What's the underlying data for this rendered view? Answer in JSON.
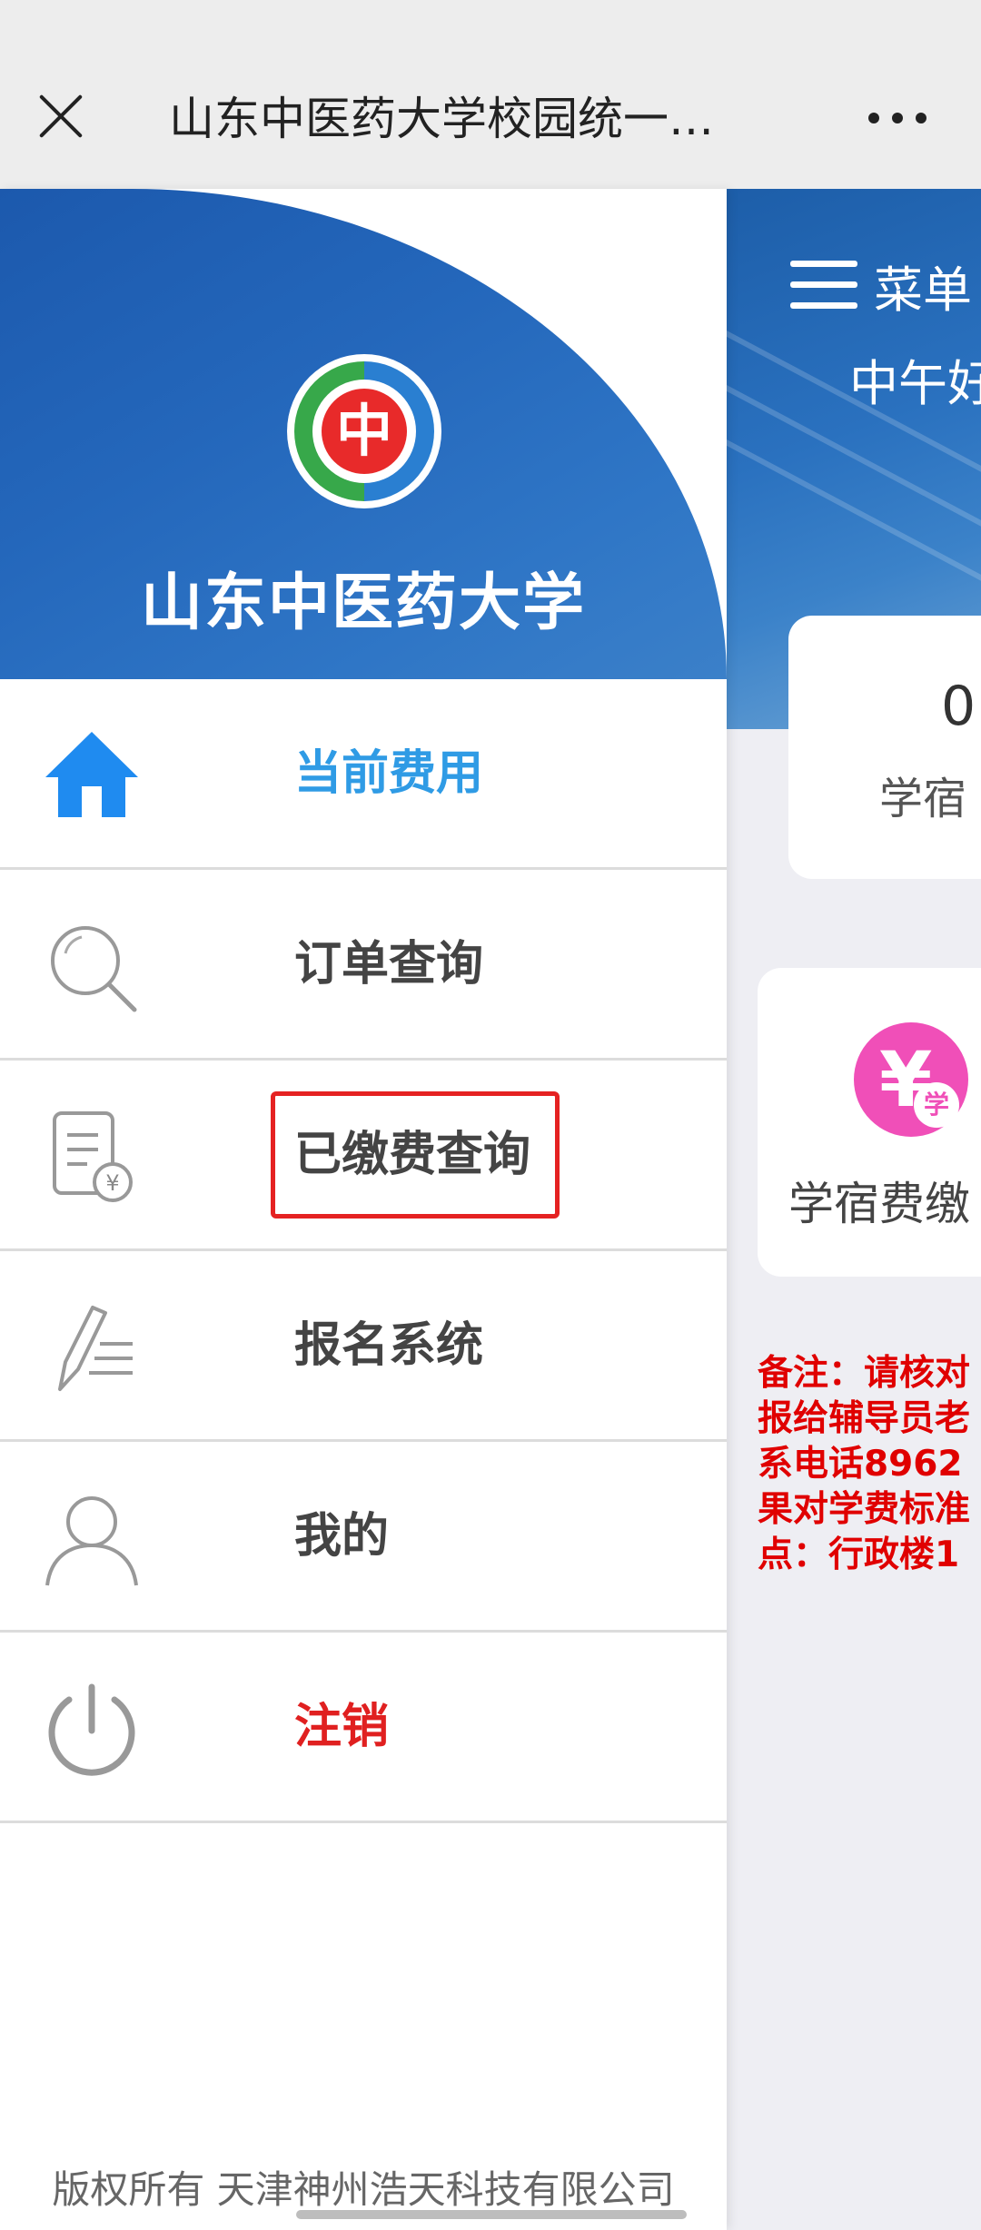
{
  "topbar": {
    "title": "山东中医药大学校园统一…"
  },
  "drawer": {
    "school_name": "山东中医药大学",
    "logo_text": "中",
    "menu": [
      {
        "label": "当前费用",
        "icon": "home-icon",
        "state": "active"
      },
      {
        "label": "订单查询",
        "icon": "search-icon",
        "state": "normal"
      },
      {
        "label": "已缴费查询",
        "icon": "receipt-icon",
        "state": "highlighted"
      },
      {
        "label": "报名系统",
        "icon": "pen-icon",
        "state": "normal"
      },
      {
        "label": "我的",
        "icon": "user-icon",
        "state": "normal"
      },
      {
        "label": "注销",
        "icon": "power-icon",
        "state": "danger"
      }
    ],
    "footer": "版权所有 天津神州浩天科技有限公司"
  },
  "background_page": {
    "menu_label": "菜单",
    "greeting": "中午好",
    "card1_value": "0",
    "card1_label": "学宿",
    "card2_icon_badge": "学",
    "card2_label": "学宿费缴",
    "remark_lines": [
      "备注：请核对",
      "报给辅导员老",
      "系电话8962",
      "果对学费标准",
      "点：行政楼1"
    ]
  },
  "colors": {
    "accent": "#2f9be5",
    "danger": "#e02020",
    "header_blue": "#2467bb",
    "highlight_box": "#e52222",
    "payment_icon": "#f04fb8"
  }
}
